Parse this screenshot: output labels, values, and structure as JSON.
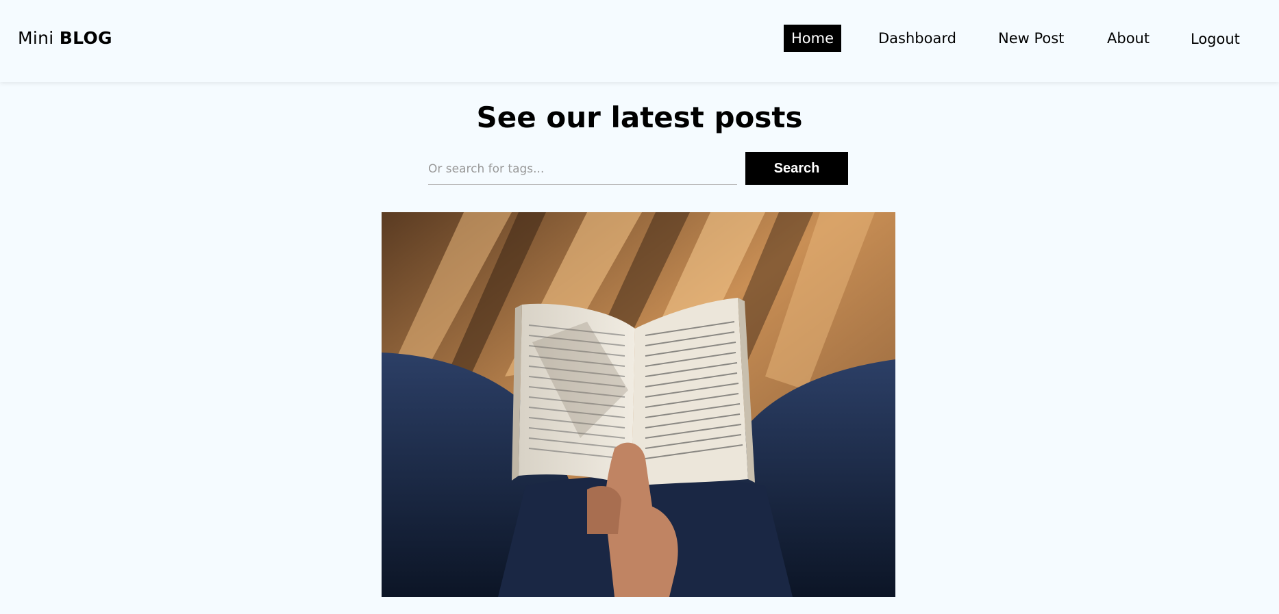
{
  "header": {
    "brand": {
      "light": "Mini",
      "bold": "BLOG"
    },
    "nav": [
      {
        "label": "Home",
        "active": true
      },
      {
        "label": "Dashboard",
        "active": false
      },
      {
        "label": "New Post",
        "active": false
      },
      {
        "label": "About",
        "active": false
      },
      {
        "label": "Logout",
        "active": false
      }
    ]
  },
  "main": {
    "title": "See our latest posts",
    "search": {
      "placeholder": "Or search for tags...",
      "value": "",
      "button_label": "Search"
    }
  },
  "colors": {
    "background": "#f5fbff",
    "active_nav_bg": "#000000",
    "button_bg": "#000000"
  }
}
